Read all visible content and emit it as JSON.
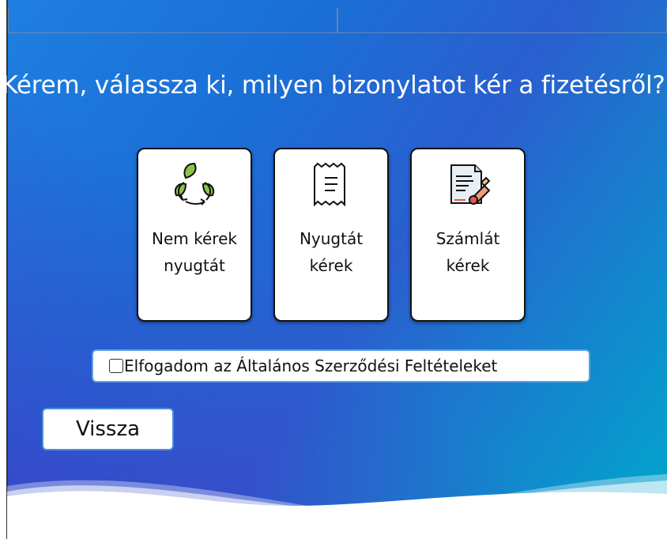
{
  "title": "Kérem, válassza ki, milyen bizonylatot kér a fizetésről?",
  "options": [
    {
      "line1": "Nem kérek",
      "line2": "nyugtát",
      "icon": "recycle-icon"
    },
    {
      "line1": "Nyugtát",
      "line2": "kérek",
      "icon": "receipt-icon"
    },
    {
      "line1": "Számlát",
      "line2": "kérek",
      "icon": "invoice-icon"
    }
  ],
  "terms": {
    "label": "Elfogadom az Általános Szerződési Feltételeket",
    "checked": false
  },
  "back_label": "Vissza",
  "colors": {
    "accent": "#4a90d9",
    "gradient_start": "#1f7fe0",
    "gradient_end": "#00a8cc",
    "leaf_green": "#8bc34a"
  }
}
